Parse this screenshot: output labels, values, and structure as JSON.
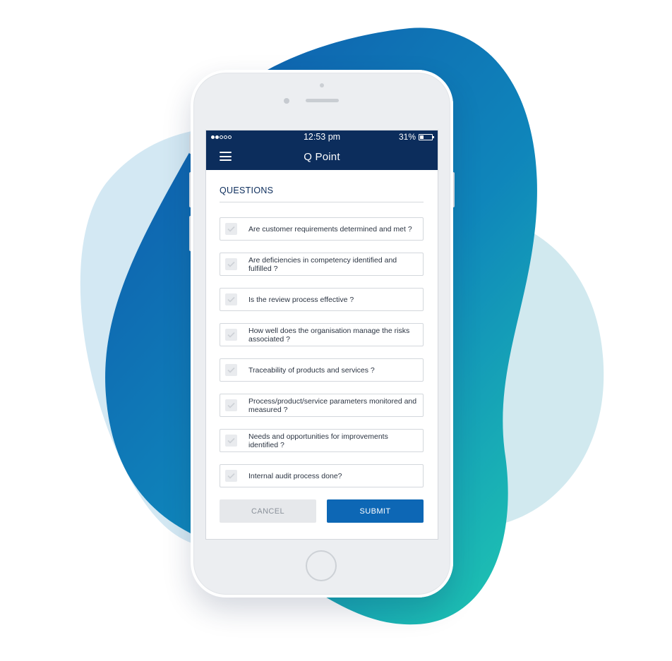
{
  "status_bar": {
    "signal_filled": 2,
    "signal_total": 5,
    "time": "12:53 pm",
    "battery_text": "31%",
    "battery_level": 0.31
  },
  "header": {
    "title": "Q Point",
    "menu_icon": "hamburger-menu-icon"
  },
  "section": {
    "title": "QUESTIONS"
  },
  "questions": [
    {
      "label": "Are customer requirements determined and met ?",
      "checked": false
    },
    {
      "label": "Are deficiencies in competency identified and fulfilled ?",
      "checked": false
    },
    {
      "label": "Is the review process effective ?",
      "checked": false
    },
    {
      "label": "How well does the organisation manage the risks associated ?",
      "checked": false
    },
    {
      "label": "Traceability of products and services ?",
      "checked": false
    },
    {
      "label": "Process/product/service parameters monitored and measured ?",
      "checked": false
    },
    {
      "label": "Needs and opportunities for improvements identified ?",
      "checked": false
    },
    {
      "label": "Internal audit process done?",
      "checked": false
    }
  ],
  "actions": {
    "cancel_label": "CANCEL",
    "submit_label": "SUBMIT"
  },
  "colors": {
    "header_bg": "#0c2d5c",
    "submit_bg": "#0d67b5",
    "cancel_bg": "#e6e8eb",
    "blob_blue": "#0a6fb8",
    "blob_teal": "#19b9b4",
    "blob_light": "#cfe6f0"
  }
}
